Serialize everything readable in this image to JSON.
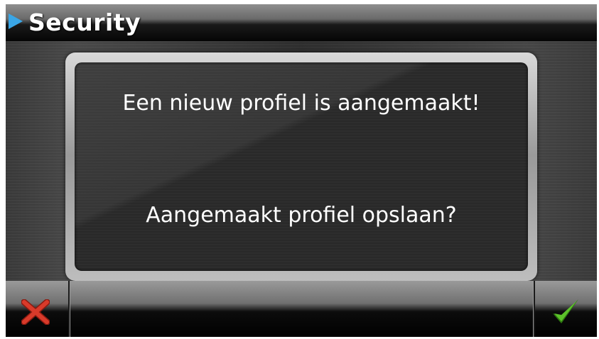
{
  "header": {
    "title": "Security",
    "arrow_icon": "play-arrow-icon",
    "arrow_color": "#3aa6e6"
  },
  "dialog": {
    "message": "Een nieuw profiel is aangemaakt!",
    "question": "Aangemaakt profiel opslaan?"
  },
  "footer": {
    "cancel_icon": "close-x-icon",
    "cancel_color": "#d93a2a",
    "confirm_icon": "checkmark-icon",
    "confirm_color": "#4cae1f"
  }
}
